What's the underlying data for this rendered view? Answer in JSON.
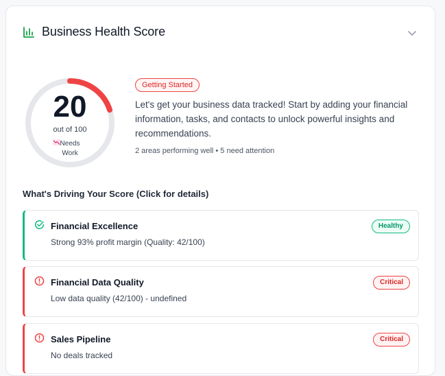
{
  "header": {
    "title": "Business Health Score",
    "icon": "bar-chart-icon",
    "collapse_icon": "chevron-down-icon"
  },
  "score": {
    "value": "20",
    "out_of": "out of 100",
    "status_label": "Needs Work",
    "fraction": 0.2,
    "track_color": "#e5e7eb",
    "progress_color": "#ef4444"
  },
  "summary": {
    "badge": "Getting Started",
    "text": "Let's get your business data tracked! Start by adding your financial information, tasks, and contacts to unlock powerful insights and recommendations.",
    "areas": "2 areas performing well • 5 need attention"
  },
  "drivers": {
    "title": "What's Driving Your Score (Click for details)",
    "items": [
      {
        "name": "Financial Excellence",
        "description": "Strong 93% profit margin (Quality: 42/100)",
        "status": "Healthy",
        "icon": "check-circle-icon",
        "color": "#10b981"
      },
      {
        "name": "Financial Data Quality",
        "description": "Low data quality (42/100) - undefined",
        "status": "Critical",
        "icon": "alert-circle-icon",
        "color": "#ef4444"
      },
      {
        "name": "Sales Pipeline",
        "description": "No deals tracked",
        "status": "Critical",
        "icon": "alert-circle-icon",
        "color": "#ef4444"
      }
    ]
  }
}
